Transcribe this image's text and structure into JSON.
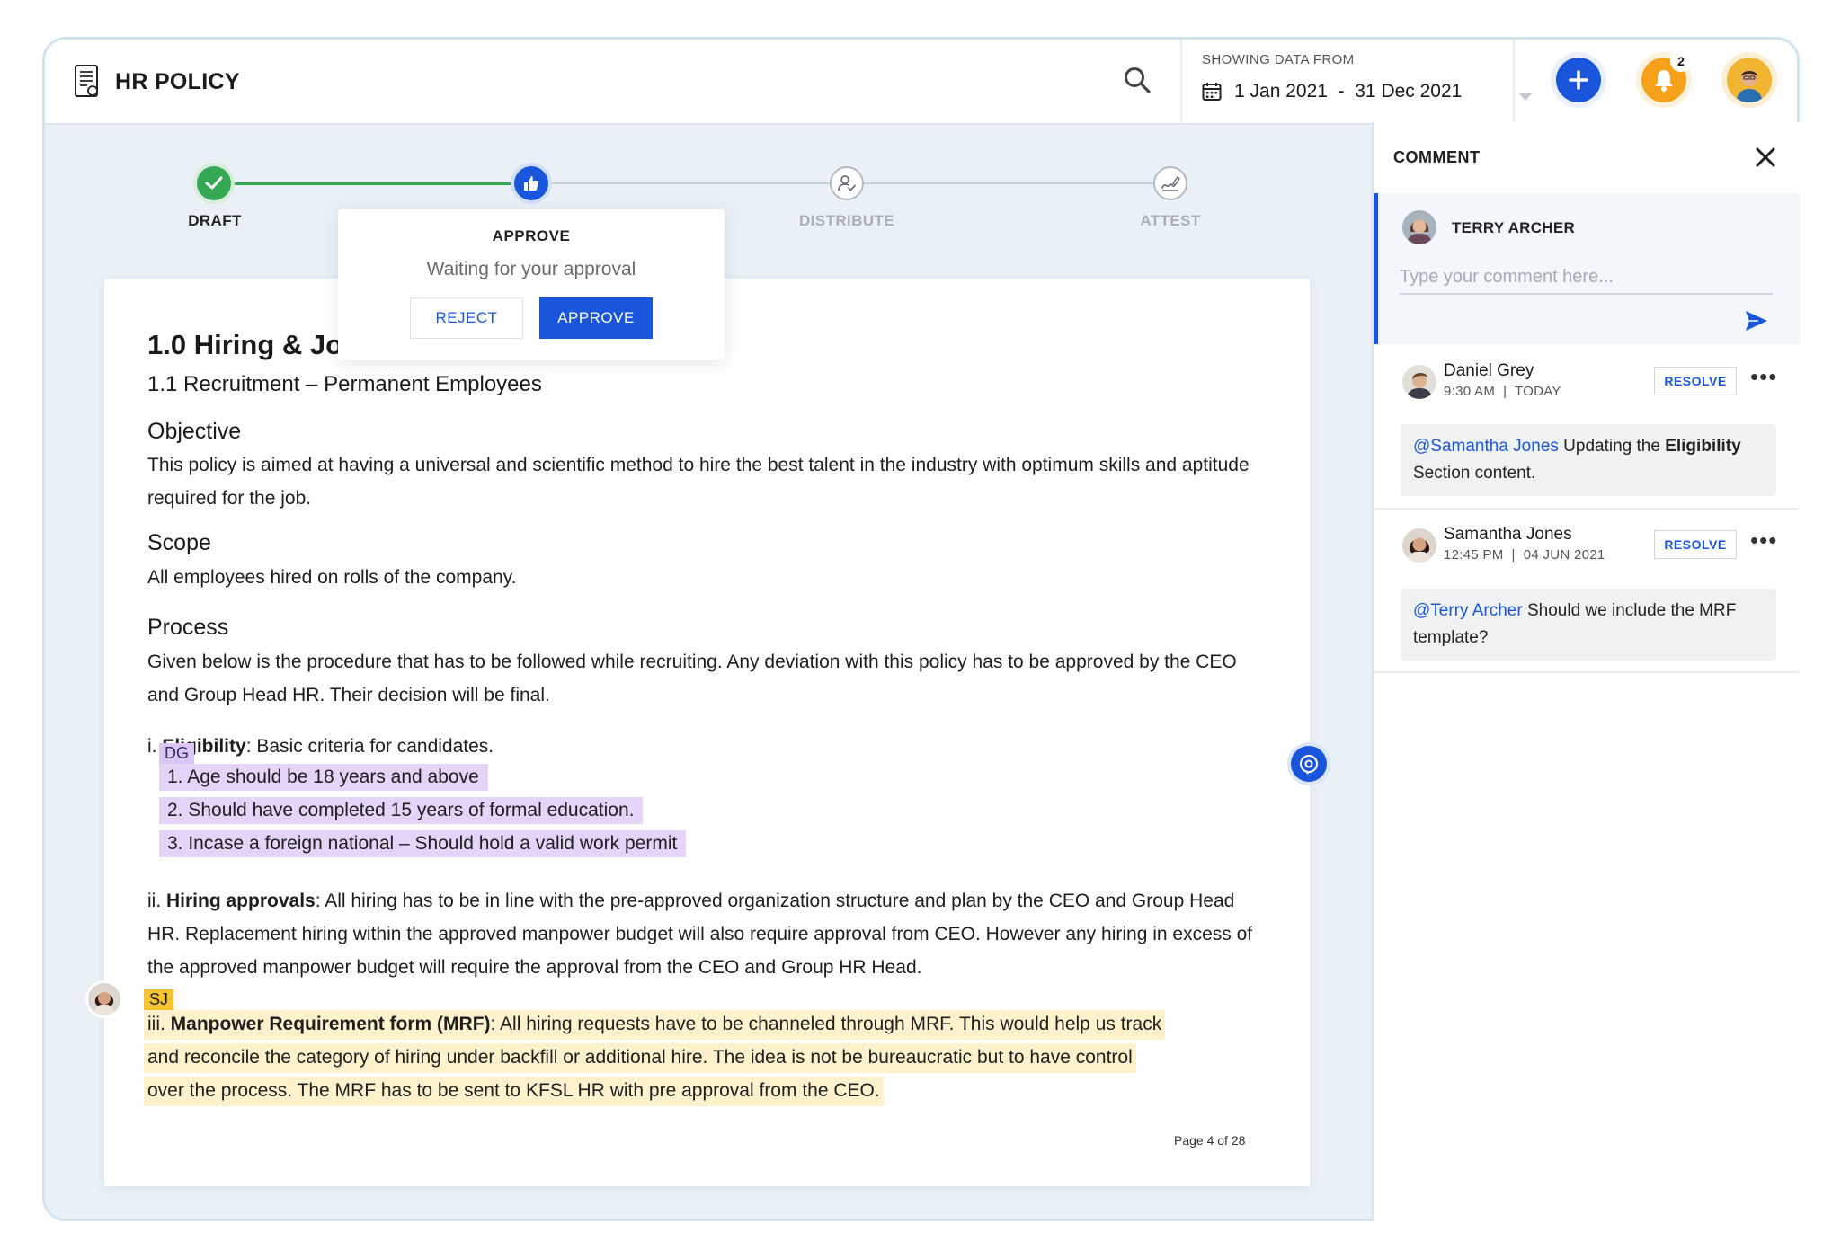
{
  "header": {
    "title": "HR POLICY",
    "date_caption": "SHOWING DATA FROM",
    "date_range": "1 Jan 2021  -  31 Dec 2021",
    "notification_count": "2"
  },
  "workflow": {
    "steps": [
      {
        "label": "DRAFT",
        "state": "done"
      },
      {
        "label": "APPROVE",
        "state": "current"
      },
      {
        "label": "DISTRIBUTE",
        "state": "pending"
      },
      {
        "label": "ATTEST",
        "state": "pending"
      }
    ],
    "popover": {
      "title": "APPROVE",
      "subtitle": "Waiting for your approval",
      "reject_label": "REJECT",
      "approve_label": "APPROVE"
    }
  },
  "document": {
    "heading_visible": "1.0 Hiring & Jo",
    "subheading": "1.1 Recruitment – Permanent Employees",
    "objective_title": "Objective",
    "objective_text": "This policy is aimed at having a universal and scientific method to hire the best talent in the industry with optimum skills and aptitude required for the job.",
    "scope_title": "Scope",
    "scope_text": "All employees hired on rolls of the company.",
    "process_title": "Process",
    "process_text": "Given below is the procedure that has to be followed while recruiting. Any deviation with this policy has to be approved by the CEO and Group Head HR. Their decision will be final.",
    "eligibility": {
      "prefix": "i. ",
      "term": "Eligibility",
      "rest": ": Basic criteria for candidates.",
      "tag": "DG",
      "items": [
        "1.  Age should be 18 years and above",
        "2. Should have completed 15 years of formal education.",
        "3. Incase a foreign national – Should hold a valid work permit"
      ]
    },
    "hiring_approvals": {
      "prefix": "ii. ",
      "term": "Hiring approvals",
      "rest": ": All hiring has to be in line with the pre-approved organization structure and plan by the CEO and Group Head HR. Replacement hiring within the approved manpower budget will also require approval from CEO. However any hiring in excess of the approved manpower budget will require the approval from the CEO and Group HR Head."
    },
    "mrf": {
      "tag": "SJ",
      "line1_prefix": "iii. ",
      "line1_term": "Manpower Requirement form (MRF)",
      "line1_rest": ": All hiring requests have to be channeled through MRF. This would help us track",
      "line2": "and reconcile the category of hiring under backfill or additional hire. The idea is not be bureaucratic but to have control",
      "line3": "over the process. The MRF has to be sent to KFSL HR with pre approval from the CEO."
    },
    "page_indicator": "Page 4 of 28"
  },
  "comments_panel": {
    "title": "COMMENT",
    "composer": {
      "author": "TERRY ARCHER",
      "placeholder": "Type your comment here..."
    },
    "threads": [
      {
        "author": "Daniel Grey",
        "time": "9:30 AM",
        "date": "TODAY",
        "resolve_label": "RESOLVE",
        "mention": "@Samantha Jones",
        "text_before": " Updating the ",
        "bold": "Eligibility",
        "text_after": " Section content."
      },
      {
        "author": "Samantha Jones",
        "time": "12:45 PM",
        "date": "04 JUN 2021",
        "resolve_label": "RESOLVE",
        "mention": "@Terry Archer",
        "text": " Should we include the MRF template?"
      }
    ]
  },
  "colors": {
    "accent": "#1a56db",
    "done_green": "#34a853",
    "bell_orange": "#f5a11a",
    "highlight_purple": "#e4d4f8",
    "highlight_yellow": "#fdf2cc"
  },
  "icons": {
    "logo": "document-certificate-icon",
    "search": "search-icon",
    "calendar": "calendar-icon",
    "add": "plus-icon",
    "bell": "bell-icon",
    "close": "close-icon",
    "send": "send-icon",
    "more": "more-horizontal-icon",
    "comment": "comment-icon"
  }
}
